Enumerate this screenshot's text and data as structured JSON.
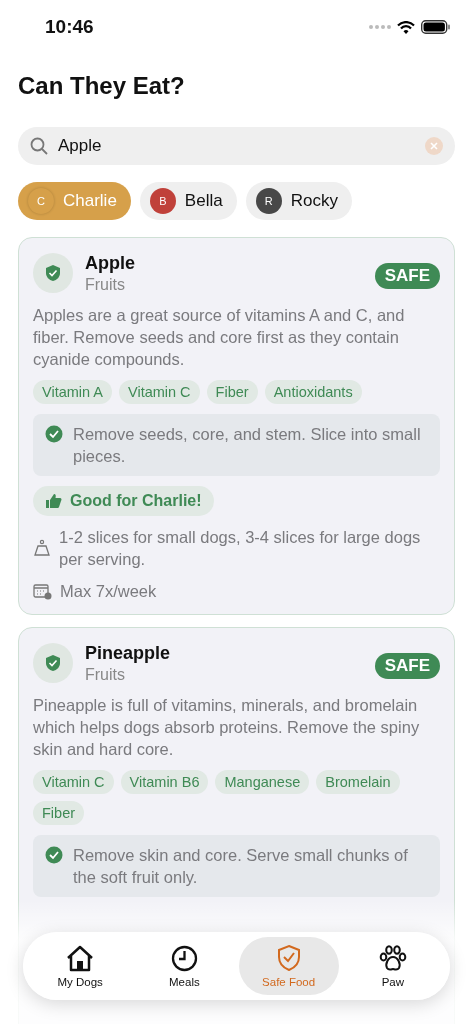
{
  "status_bar": {
    "time": "10:46"
  },
  "title": "Can They Eat?",
  "search": {
    "value": "Apple"
  },
  "dogs": [
    {
      "initial": "C",
      "name": "Charlie",
      "color": "#d6a04a",
      "selected": true
    },
    {
      "initial": "B",
      "name": "Bella",
      "color": "#c0413a",
      "selected": false
    },
    {
      "initial": "R",
      "name": "Rocky",
      "color": "#484848",
      "selected": false
    }
  ],
  "foods": [
    {
      "name": "Apple",
      "category": "Fruits",
      "status": "SAFE",
      "description": "Apples are a great source of vitamins A and C, and fiber. Remove seeds and core first as they contain cyanide compounds.",
      "nutrients": [
        "Vitamin A",
        "Vitamin C",
        "Fiber",
        "Antioxidants"
      ],
      "tip": "Remove seeds, core, and stem. Slice into small pieces.",
      "verdict": "Good for Charlie!",
      "serving": "1-2 slices for small dogs, 3-4 slices for large dogs per serving.",
      "frequency": "Max 7x/week"
    },
    {
      "name": "Pineapple",
      "category": "Fruits",
      "status": "SAFE",
      "description": "Pineapple is full of vitamins, minerals, and bromelain which helps dogs absorb proteins. Remove the spiny skin and hard core.",
      "nutrients": [
        "Vitamin C",
        "Vitamin B6",
        "Manganese",
        "Bromelain",
        "Fiber"
      ],
      "tip": "Remove skin and core. Serve small chunks of the soft fruit only."
    }
  ],
  "tabs": [
    {
      "label": "My Dogs",
      "kind": "home",
      "selected": false
    },
    {
      "label": "Meals",
      "kind": "clock",
      "selected": false
    },
    {
      "label": "Safe Food",
      "kind": "shield",
      "selected": true
    },
    {
      "label": "Paw",
      "kind": "paw",
      "selected": false
    }
  ]
}
